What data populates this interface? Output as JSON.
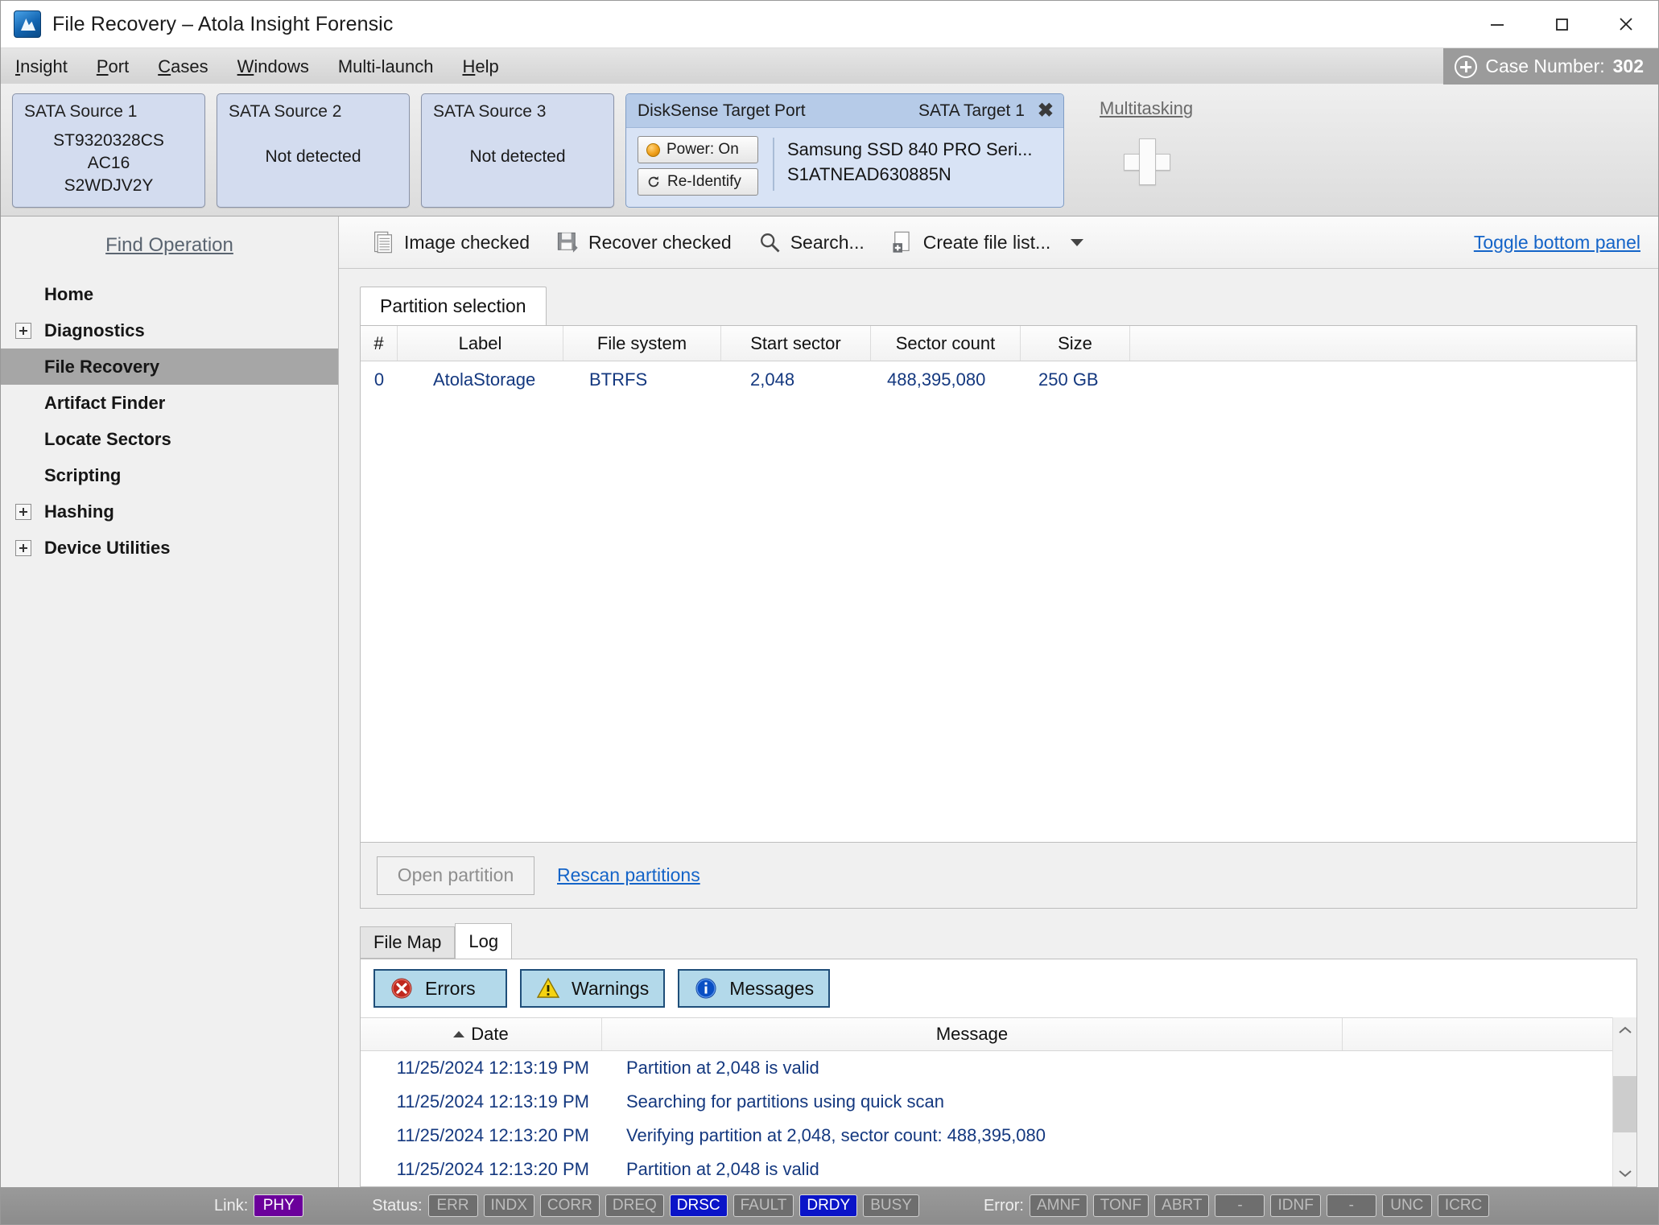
{
  "window": {
    "title": "File Recovery – Atola Insight Forensic",
    "minimize": "–",
    "maximize": "□",
    "close": "✕"
  },
  "menu": {
    "items": [
      "Insight",
      "Port",
      "Cases",
      "Windows",
      "Multi-launch",
      "Help"
    ],
    "case_label": "Case Number:",
    "case_number": "302"
  },
  "devices": {
    "sources": [
      {
        "title": "SATA Source 1",
        "model": "ST9320328CS",
        "firmware": "AC16",
        "serial": "S2WDJV2Y",
        "detected": true,
        "status": ""
      },
      {
        "title": "SATA Source 2",
        "model": "",
        "firmware": "",
        "serial": "",
        "detected": false,
        "status": "Not detected"
      },
      {
        "title": "SATA Source 3",
        "model": "",
        "firmware": "",
        "serial": "",
        "detected": false,
        "status": "Not detected"
      }
    ],
    "target": {
      "title": "DiskSense Target Port",
      "port_label": "SATA Target 1",
      "close": "✖",
      "power_button": "Power: On",
      "reidentify_button": "Re-Identify",
      "model": "Samsung SSD 840 PRO Seri...",
      "serial": "S1ATNEAD630885N"
    },
    "multitasking": {
      "label": "Multitasking"
    }
  },
  "sidebar": {
    "find_operation": "Find Operation",
    "items": [
      {
        "label": "Home",
        "expandable": false,
        "selected": false
      },
      {
        "label": "Diagnostics",
        "expandable": true,
        "selected": false
      },
      {
        "label": "File Recovery",
        "expandable": false,
        "selected": true
      },
      {
        "label": "Artifact Finder",
        "expandable": false,
        "selected": false
      },
      {
        "label": "Locate Sectors",
        "expandable": false,
        "selected": false
      },
      {
        "label": "Scripting",
        "expandable": false,
        "selected": false
      },
      {
        "label": "Hashing",
        "expandable": true,
        "selected": false
      },
      {
        "label": "Device Utilities",
        "expandable": true,
        "selected": false
      }
    ]
  },
  "toolbar": {
    "image_checked": "Image checked",
    "recover_checked": "Recover checked",
    "search": "Search...",
    "create_file_list": "Create file list...",
    "toggle_bottom_panel": "Toggle bottom panel"
  },
  "partition_panel": {
    "tab": "Partition selection",
    "columns": [
      "#",
      "Label",
      "File system",
      "Start sector",
      "Sector count",
      "Size",
      ""
    ],
    "rows": [
      {
        "num": "0",
        "label": "AtolaStorage",
        "fs": "BTRFS",
        "start": "2,048",
        "count": "488,395,080",
        "size": "250 GB"
      }
    ],
    "open_partition": "Open partition",
    "rescan_partitions": "Rescan partitions"
  },
  "bottom_panel": {
    "tabs": [
      {
        "label": "File Map",
        "active": false
      },
      {
        "label": "Log",
        "active": true
      }
    ],
    "filters": [
      {
        "label": "Errors",
        "icon": "error-icon",
        "active": true
      },
      {
        "label": "Warnings",
        "icon": "warning-icon",
        "active": true
      },
      {
        "label": "Messages",
        "icon": "info-icon",
        "active": true
      }
    ],
    "columns": [
      "Date",
      "Message",
      ""
    ],
    "sort": "ascending",
    "rows": [
      {
        "date": "11/25/2024 12:13:19 PM",
        "message": "Partition at 2,048 is valid"
      },
      {
        "date": "11/25/2024 12:13:19 PM",
        "message": "Searching for partitions using quick scan"
      },
      {
        "date": "11/25/2024 12:13:20 PM",
        "message": "Verifying partition at 2,048, sector count: 488,395,080"
      },
      {
        "date": "11/25/2024 12:13:20 PM",
        "message": "Partition at 2,048 is valid"
      }
    ]
  },
  "statusbar": {
    "link_label": "Link:",
    "link_value": "PHY",
    "status_label": "Status:",
    "status_flags": [
      {
        "label": "ERR",
        "active": false
      },
      {
        "label": "INDX",
        "active": false
      },
      {
        "label": "CORR",
        "active": false
      },
      {
        "label": "DREQ",
        "active": false
      },
      {
        "label": "DRSC",
        "active": true
      },
      {
        "label": "FAULT",
        "active": false
      },
      {
        "label": "DRDY",
        "active": true
      },
      {
        "label": "BUSY",
        "active": false
      }
    ],
    "error_label": "Error:",
    "error_flags": [
      {
        "label": "AMNF",
        "active": false
      },
      {
        "label": "TONF",
        "active": false
      },
      {
        "label": "ABRT",
        "active": false
      },
      {
        "label": "-",
        "active": false
      },
      {
        "label": "IDNF",
        "active": false
      },
      {
        "label": "-",
        "active": false
      },
      {
        "label": "UNC",
        "active": false
      },
      {
        "label": "ICRC",
        "active": false
      }
    ]
  },
  "colors": {
    "accent_link": "#1464c8",
    "selection": "#a6a6a6",
    "badge_on": "#0a14c8",
    "badge_phy": "#6b009b",
    "filter_active_bg": "#b3d9ea",
    "grid_text": "#14387f"
  }
}
